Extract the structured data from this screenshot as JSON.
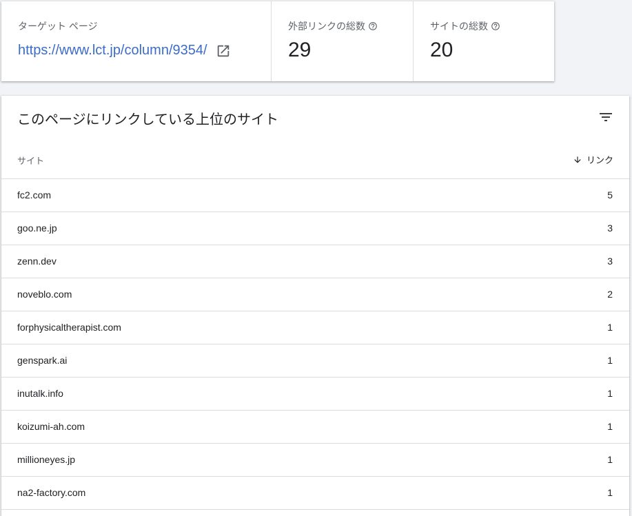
{
  "summary": {
    "target": {
      "label": "ターゲット ページ",
      "url": "https://www.lct.jp/column/9354/",
      "external_icon": "open-in-new-icon"
    },
    "total_links": {
      "label": "外部リンクの総数",
      "value": "29",
      "help_icon": "help-circle-icon"
    },
    "total_sites": {
      "label": "サイトの総数",
      "value": "20",
      "help_icon": "help-circle-icon"
    }
  },
  "table": {
    "title": "このページにリンクしている上位のサイト",
    "filter_icon": "filter-icon",
    "columns": {
      "site": "サイト",
      "links": "リンク",
      "sort_icon": "arrow-down-icon"
    },
    "rows": [
      {
        "site": "fc2.com",
        "links": "5"
      },
      {
        "site": "goo.ne.jp",
        "links": "3"
      },
      {
        "site": "zenn.dev",
        "links": "3"
      },
      {
        "site": "noveblo.com",
        "links": "2"
      },
      {
        "site": "forphysicaltherapist.com",
        "links": "1"
      },
      {
        "site": "genspark.ai",
        "links": "1"
      },
      {
        "site": "inutalk.info",
        "links": "1"
      },
      {
        "site": "koizumi-ah.com",
        "links": "1"
      },
      {
        "site": "millioneyes.jp",
        "links": "1"
      },
      {
        "site": "na2-factory.com",
        "links": "1"
      }
    ]
  },
  "colors": {
    "link": "#3c6cc9",
    "background": "#f1f3f6",
    "divider": "#dadce0",
    "muted_text": "#5f6368"
  }
}
